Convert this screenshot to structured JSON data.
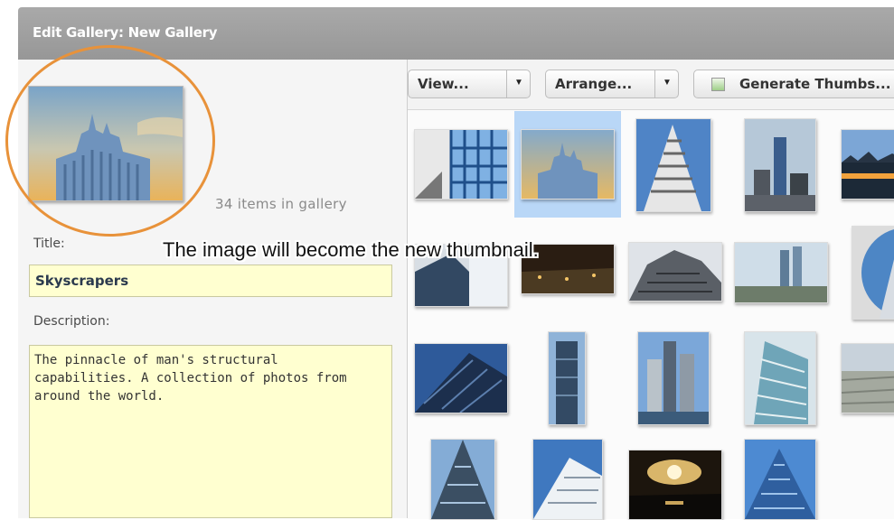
{
  "window": {
    "title": "Edit Gallery: New Gallery"
  },
  "gallery": {
    "count_text": "34 items in gallery",
    "title_label": "Title:",
    "title_value": "Skyscrapers",
    "description_label": "Description:",
    "description_value": "The pinnacle of man's structural\ncapabilities.  A collection of photos from\naround the world."
  },
  "toolbar": {
    "view_label": "View...",
    "arrange_label": "Arrange...",
    "generate_label": "Generate Thumbs..."
  },
  "overlay": {
    "caption": "The image will become the new thumbnail."
  },
  "colors": {
    "highlight": "#e8923a",
    "field_bg": "#ffffd0",
    "selection": "#b9d7f7",
    "titlebar": "#a0a0a0"
  },
  "thumbnails": [
    "skyscraper-photo-1",
    "skyscraper-photo-2",
    "skyscraper-photo-3",
    "skyscraper-photo-4",
    "skyscraper-photo-5",
    "skyscraper-photo-6",
    "skyscraper-photo-7",
    "skyscraper-photo-8",
    "skyscraper-photo-9",
    "skyscraper-photo-10",
    "skyscraper-photo-11",
    "skyscraper-photo-12",
    "skyscraper-photo-13",
    "skyscraper-photo-14",
    "skyscraper-photo-15",
    "skyscraper-photo-16",
    "skyscraper-photo-17",
    "skyscraper-photo-18",
    "skyscraper-photo-19"
  ]
}
